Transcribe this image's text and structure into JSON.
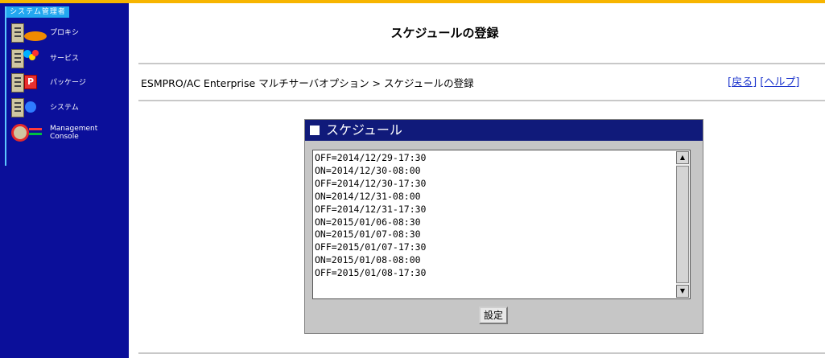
{
  "sidebar": {
    "header": "システム管理者",
    "items": [
      {
        "label": "プロキシ",
        "icon": "proxy-icon"
      },
      {
        "label": "サービス",
        "icon": "service-icon"
      },
      {
        "label": "パッケージ",
        "icon": "package-icon"
      },
      {
        "label": "システム",
        "icon": "system-icon"
      },
      {
        "label_line1": "Management",
        "label_line2": "Console",
        "icon": "management-console-icon"
      }
    ]
  },
  "page": {
    "title": "スケジュールの登録",
    "breadcrumb": "ESMPRO/AC Enterprise マルチサーバオプション > スケジュールの登録",
    "back_link": "[戻る]",
    "help_link": "[ヘルプ]"
  },
  "schedule": {
    "header": "スケジュール",
    "entries": [
      "OFF=2014/12/29-17:30",
      "ON=2014/12/30-08:00",
      "OFF=2014/12/30-17:30",
      "ON=2014/12/31-08:00",
      "OFF=2014/12/31-17:30",
      "ON=2015/01/06-08:30",
      "ON=2015/01/07-08:30",
      "OFF=2015/01/07-17:30",
      "ON=2015/01/08-08:00",
      "OFF=2015/01/08-17:30"
    ],
    "set_button": "設定"
  },
  "colors": {
    "sidebar": "#0b0f9a",
    "top_bar": "#f7b500",
    "panel_header": "#101a7a",
    "link": "#1a33cc"
  }
}
